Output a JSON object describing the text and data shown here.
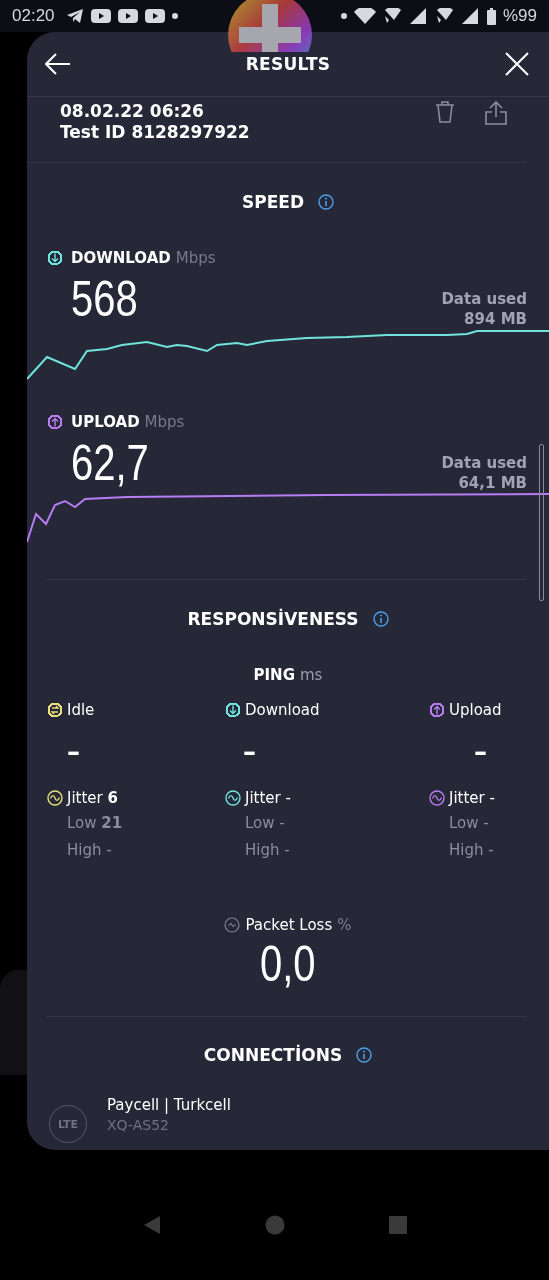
{
  "status_bar": {
    "time": "02:20",
    "battery": "%99"
  },
  "header": {
    "title": "RESULTS"
  },
  "test": {
    "date": "08.02.22 06:26",
    "test_id": "Test ID 8128297922"
  },
  "speed": {
    "title": "SPEED",
    "results": [
      {
        "kind": "download",
        "label": "DOWNLOAD",
        "unit": "Mbps",
        "value": "568",
        "data_used_label": "Data used",
        "data_used": "894 MB",
        "color": "#6fe3dc"
      },
      {
        "kind": "upload",
        "label": "UPLOAD",
        "unit": "Mbps",
        "value": "62,7",
        "data_used_label": "Data used",
        "data_used": "64,1 MB",
        "color": "#b77cf2"
      }
    ]
  },
  "responsiveness": {
    "title": "RESPONSİVENESS",
    "ping_label": "PING",
    "ping_unit": "ms",
    "columns": [
      {
        "kind": "idle",
        "label": "Idle",
        "color": "#e8e07a",
        "value": "–",
        "jitter": "Jitter **6**",
        "low": "Low **21**",
        "high": "High -"
      },
      {
        "kind": "download",
        "label": "Download",
        "color": "#6fe3dc",
        "value": "–",
        "jitter": "Jitter -",
        "low": "Low -",
        "high": "High -"
      },
      {
        "kind": "upload",
        "label": "Upload",
        "color": "#b77cf2",
        "value": "–",
        "jitter": "Jitter -",
        "low": "Low -",
        "high": "High -"
      }
    ]
  },
  "packet_loss": {
    "label": "Packet Loss",
    "unit": "%",
    "value": "0,0"
  },
  "connections": {
    "title": "CONNECTİONS",
    "items": [
      {
        "badge": "LTE",
        "name": "Paycell | Turkcell",
        "server": "XQ-AS52"
      }
    ]
  }
}
